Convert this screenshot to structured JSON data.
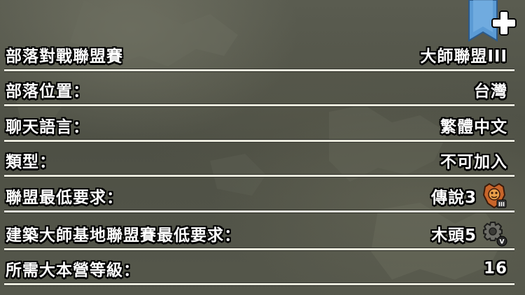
{
  "rows": [
    {
      "label": "部落對戰聯盟賽",
      "value": "大師聯盟III"
    },
    {
      "label": "部落位置：",
      "value": "台灣"
    },
    {
      "label": "聊天語言：",
      "value": "繁體中文"
    },
    {
      "label": "類型：",
      "value": "不可加入"
    },
    {
      "label": "聯盟最低要求：",
      "value": "傳說3",
      "badge_icon": "legend-league-shield-icon",
      "badge_text": "III"
    },
    {
      "label": "建築大師基地聯盟賽最低要求：",
      "value": "木頭5",
      "badge_icon": "wood-league-gear-icon",
      "badge_text": "V"
    },
    {
      "label": "所需大本營等級：",
      "value": "16"
    }
  ],
  "corner": {
    "icon": "plus-icon"
  },
  "colors": {
    "divider": "#e9e9dc",
    "text": "#ffffff",
    "outline": "#000000",
    "corner_tab": "#5b9bd5",
    "legend_badge": "#c8652a",
    "wood_badge": "#6e6e68"
  }
}
